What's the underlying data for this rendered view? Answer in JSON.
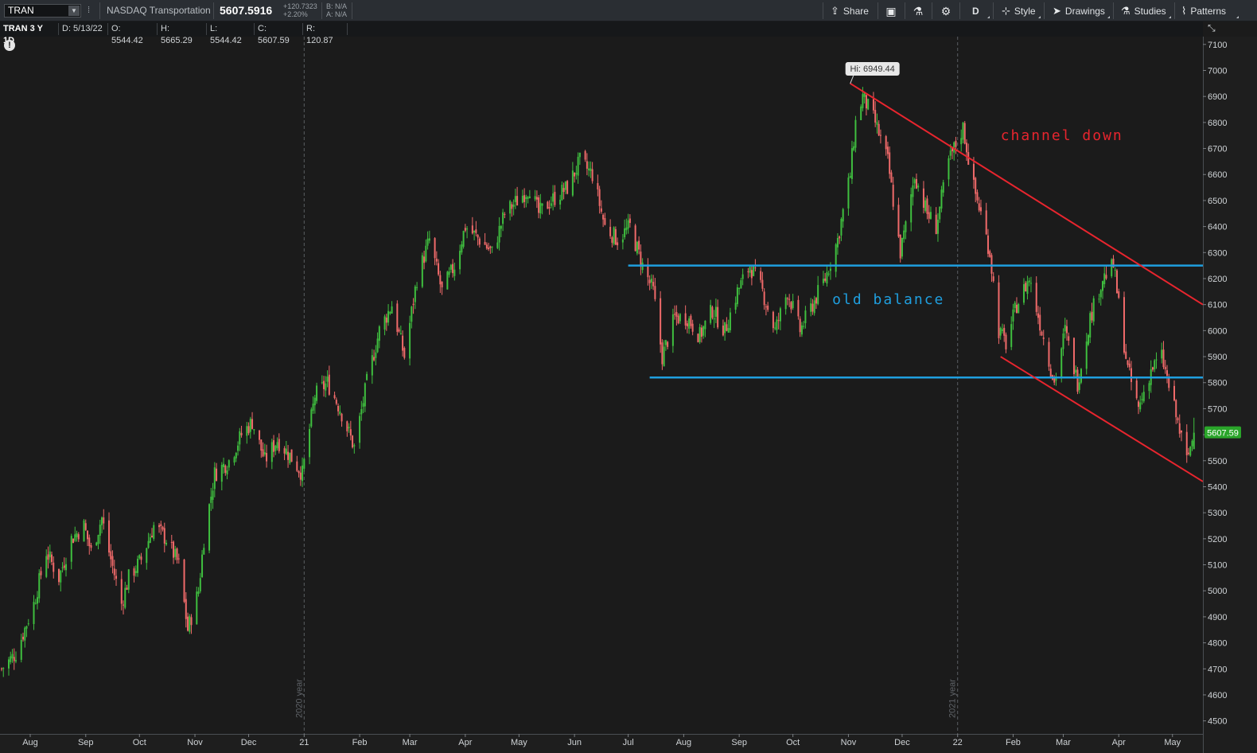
{
  "toolbar": {
    "symbol": "TRAN",
    "description": "NASDAQ Transportation",
    "last_price": "5607.5916",
    "net_change": "+120.7323",
    "pct_change": "+2.20%",
    "bid": "B: N/A",
    "ask": "A: N/A",
    "share_label": "Share",
    "period_label": "D",
    "style_label": "Style",
    "drawings_label": "Drawings",
    "studies_label": "Studies",
    "patterns_label": "Patterns"
  },
  "info": {
    "title": "TRAN 3 Y 1D",
    "date": "D: 5/13/22",
    "open": "O: 5544.42",
    "high": "H: 5665.29",
    "low": "L: 5544.42",
    "close": "C: 5607.59",
    "range": "R: 120.87"
  },
  "colors": {
    "up": "#3fbf3f",
    "down": "#f06a6a",
    "level": "#1f9fdf",
    "channel": "#e8252e",
    "bg": "#1b1b1b",
    "last_bubble": "#2aa52a"
  },
  "chart_data": {
    "type": "candlestick",
    "y_axis": {
      "min": 4450,
      "max": 7130,
      "ticks": [
        4500,
        4600,
        4700,
        4800,
        4900,
        5000,
        5100,
        5200,
        5300,
        5400,
        5500,
        5600,
        5700,
        5800,
        5900,
        6000,
        6100,
        6200,
        6300,
        6400,
        6500,
        6600,
        6700,
        6800,
        6900,
        7000,
        7100
      ]
    },
    "x_axis": {
      "ticks": [
        {
          "date": "2020-08-01",
          "label": "Aug"
        },
        {
          "date": "2020-09-01",
          "label": "Sep"
        },
        {
          "date": "2020-10-01",
          "label": "Oct"
        },
        {
          "date": "2020-11-01",
          "label": "Nov"
        },
        {
          "date": "2020-12-01",
          "label": "Dec"
        },
        {
          "date": "2021-01-01",
          "label": "21"
        },
        {
          "date": "2021-02-01",
          "label": "Feb"
        },
        {
          "date": "2021-03-01",
          "label": "Mar"
        },
        {
          "date": "2021-04-01",
          "label": "Apr"
        },
        {
          "date": "2021-05-01",
          "label": "May"
        },
        {
          "date": "2021-06-01",
          "label": "Jun"
        },
        {
          "date": "2021-07-01",
          "label": "Jul"
        },
        {
          "date": "2021-08-01",
          "label": "Aug"
        },
        {
          "date": "2021-09-01",
          "label": "Sep"
        },
        {
          "date": "2021-10-01",
          "label": "Oct"
        },
        {
          "date": "2021-11-01",
          "label": "Nov"
        },
        {
          "date": "2021-12-01",
          "label": "Dec"
        },
        {
          "date": "2022-01-01",
          "label": "22"
        },
        {
          "date": "2022-02-01",
          "label": "Feb"
        },
        {
          "date": "2022-03-01",
          "label": "Mar"
        },
        {
          "date": "2022-04-01",
          "label": "Apr"
        },
        {
          "date": "2022-05-01",
          "label": "May"
        }
      ],
      "start": "2020-07-16",
      "end": "2022-05-18"
    },
    "year_markers": [
      {
        "date": "2021-01-01",
        "label": "2020 year"
      },
      {
        "date": "2022-01-01",
        "label": "2021 year"
      }
    ],
    "close_path": [
      [
        "2020-07-16",
        4700
      ],
      [
        "2020-07-24",
        4760
      ],
      [
        "2020-08-03",
        4950
      ],
      [
        "2020-08-10",
        5150
      ],
      [
        "2020-08-17",
        5050
      ],
      [
        "2020-08-24",
        5200
      ],
      [
        "2020-08-31",
        5250
      ],
      [
        "2020-09-04",
        5150
      ],
      [
        "2020-09-10",
        5280
      ],
      [
        "2020-09-14",
        5150
      ],
      [
        "2020-09-21",
        4950
      ],
      [
        "2020-09-25",
        5050
      ],
      [
        "2020-10-02",
        5120
      ],
      [
        "2020-10-09",
        5250
      ],
      [
        "2020-10-16",
        5200
      ],
      [
        "2020-10-23",
        5100
      ],
      [
        "2020-10-28",
        4850
      ],
      [
        "2020-11-03",
        5000
      ],
      [
        "2020-11-06",
        5200
      ],
      [
        "2020-11-12",
        5450
      ],
      [
        "2020-11-20",
        5500
      ],
      [
        "2020-11-27",
        5600
      ],
      [
        "2020-12-03",
        5650
      ],
      [
        "2020-12-10",
        5500
      ],
      [
        "2020-12-17",
        5580
      ],
      [
        "2020-12-24",
        5520
      ],
      [
        "2020-12-31",
        5450
      ],
      [
        "2021-01-07",
        5750
      ],
      [
        "2021-01-14",
        5800
      ],
      [
        "2021-01-21",
        5700
      ],
      [
        "2021-01-29",
        5550
      ],
      [
        "2021-02-05",
        5800
      ],
      [
        "2021-02-12",
        6000
      ],
      [
        "2021-02-19",
        6100
      ],
      [
        "2021-02-26",
        5900
      ],
      [
        "2021-03-05",
        6200
      ],
      [
        "2021-03-12",
        6350
      ],
      [
        "2021-03-19",
        6150
      ],
      [
        "2021-03-26",
        6250
      ],
      [
        "2021-04-01",
        6400
      ],
      [
        "2021-04-09",
        6350
      ],
      [
        "2021-04-16",
        6300
      ],
      [
        "2021-04-23",
        6450
      ],
      [
        "2021-04-30",
        6500
      ],
      [
        "2021-05-07",
        6550
      ],
      [
        "2021-05-12",
        6450
      ],
      [
        "2021-05-19",
        6500
      ],
      [
        "2021-05-28",
        6550
      ],
      [
        "2021-06-04",
        6650
      ],
      [
        "2021-06-11",
        6600
      ],
      [
        "2021-06-18",
        6400
      ],
      [
        "2021-06-25",
        6350
      ],
      [
        "2021-07-02",
        6400
      ],
      [
        "2021-07-09",
        6250
      ],
      [
        "2021-07-15",
        6150
      ],
      [
        "2021-07-20",
        5900
      ],
      [
        "2021-07-27",
        6050
      ],
      [
        "2021-08-03",
        6050
      ],
      [
        "2021-08-10",
        5980
      ],
      [
        "2021-08-17",
        6080
      ],
      [
        "2021-08-24",
        6000
      ],
      [
        "2021-08-31",
        6150
      ],
      [
        "2021-09-07",
        6250
      ],
      [
        "2021-09-14",
        6150
      ],
      [
        "2021-09-21",
        6000
      ],
      [
        "2021-09-28",
        6150
      ],
      [
        "2021-10-05",
        6000
      ],
      [
        "2021-10-12",
        6100
      ],
      [
        "2021-10-19",
        6200
      ],
      [
        "2021-10-26",
        6350
      ],
      [
        "2021-11-02",
        6600
      ],
      [
        "2021-11-05",
        6800
      ],
      [
        "2021-11-09",
        6900
      ],
      [
        "2021-11-16",
        6800
      ],
      [
        "2021-11-23",
        6650
      ],
      [
        "2021-11-30",
        6300
      ],
      [
        "2021-12-03",
        6400
      ],
      [
        "2021-12-08",
        6600
      ],
      [
        "2021-12-15",
        6450
      ],
      [
        "2021-12-20",
        6400
      ],
      [
        "2021-12-27",
        6650
      ],
      [
        "2022-01-04",
        6780
      ],
      [
        "2022-01-10",
        6550
      ],
      [
        "2022-01-14",
        6450
      ],
      [
        "2022-01-19",
        6300
      ],
      [
        "2022-01-24",
        6000
      ],
      [
        "2022-01-28",
        5950
      ],
      [
        "2022-02-03",
        6100
      ],
      [
        "2022-02-10",
        6200
      ],
      [
        "2022-02-17",
        6000
      ],
      [
        "2022-02-24",
        5800
      ],
      [
        "2022-03-02",
        6000
      ],
      [
        "2022-03-09",
        5800
      ],
      [
        "2022-03-16",
        6050
      ],
      [
        "2022-03-23",
        6200
      ],
      [
        "2022-03-29",
        6250
      ],
      [
        "2022-04-01",
        6100
      ],
      [
        "2022-04-06",
        5850
      ],
      [
        "2022-04-12",
        5700
      ],
      [
        "2022-04-19",
        5850
      ],
      [
        "2022-04-25",
        5900
      ],
      [
        "2022-05-02",
        5700
      ],
      [
        "2022-05-09",
        5500
      ],
      [
        "2022-05-13",
        5607.59
      ]
    ],
    "high_marker": {
      "date": "2021-11-02",
      "value": 6949.44,
      "label": "Hi: 6949.44"
    },
    "last_price": {
      "value": 5607.59,
      "label": "5607.59"
    },
    "horizontal_levels": [
      {
        "name": "old-balance-top",
        "value": 6250,
        "from": "2021-07-01",
        "to": "2022-05-18"
      },
      {
        "name": "old-balance-bottom",
        "value": 5820,
        "from": "2021-07-13",
        "to": "2022-05-18"
      }
    ],
    "trendlines": [
      {
        "name": "channel-upper",
        "p1": [
          "2021-11-02",
          6950
        ],
        "p2": [
          "2022-05-18",
          6100
        ]
      },
      {
        "name": "channel-lower",
        "p1": [
          "2022-01-25",
          5900
        ],
        "p2": [
          "2022-05-18",
          5420
        ]
      }
    ],
    "annotations": [
      {
        "name": "channel-down-label",
        "text": "channel down",
        "date": "2022-01-25",
        "value": 6750,
        "color": "#e8252e"
      },
      {
        "name": "old-balance-label",
        "text": "old balance",
        "date": "2021-10-23",
        "value": 6120,
        "color": "#1f9fdf"
      }
    ]
  }
}
